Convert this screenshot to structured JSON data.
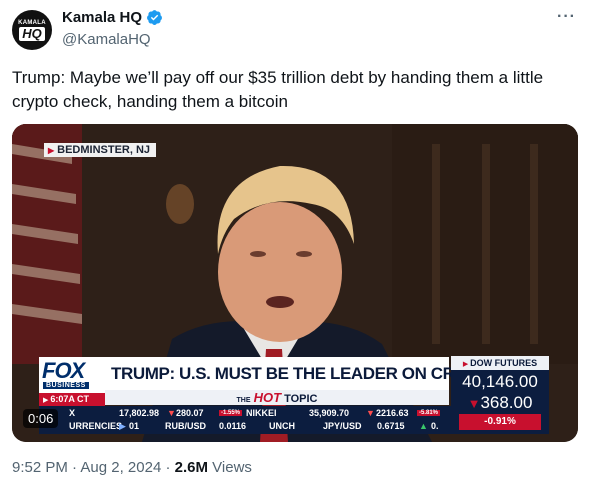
{
  "account": {
    "display_name": "Kamala HQ",
    "handle": "@KamalaHQ",
    "avatar_top": "KAMALA",
    "avatar_mid": "HQ",
    "verified": true,
    "more_label": "···"
  },
  "tweet": {
    "text": "Trump: Maybe we’ll pay off our $35 trillion debt by handing them a little crypto check, handing them a bitcoin"
  },
  "video": {
    "dateline": "BEDMINSTER, NJ",
    "timecode": "0:06",
    "chyron": {
      "network": "FOX",
      "network_sub": "BUSINESS",
      "local_time": "6:07A CT",
      "headline": "TRUMP: U.S. MUST BE THE LEADER ON CRYPTO",
      "hot_topic_the": "THE",
      "hot_topic_hot": "HOT",
      "hot_topic_topic": "TOPIC",
      "dow_title": "DOW FUTURES",
      "dow_value": "40,146.00",
      "dow_change": "368.00",
      "dow_pct": "-0.91%",
      "ticker_row1": {
        "label": "X",
        "val1": "17,802.98",
        "val2": "280.07",
        "pct1": "-1.55%",
        "name2": "NIKKEI",
        "val3": "35,909.70",
        "val4": "2216.63",
        "pct2": "-5.81%"
      },
      "ticker_row2": {
        "label": "URRENCIES",
        "arrow_val": "01",
        "pair1": "RUB/USD",
        "pair1_val": "0.0116",
        "word": "UNCH",
        "pair2": "JPY/USD",
        "pair2_val": "0.6715",
        "tail": "0."
      }
    }
  },
  "meta": {
    "time": "9:52 PM",
    "separator": "·",
    "date": "Aug 2, 2024",
    "views_count": "2.6M",
    "views_label": "Views"
  },
  "colors": {
    "verified_blue": "#1d9bf0",
    "fox_red": "#c8102e",
    "fox_navy": "#0c1d3f",
    "muted_text": "#536471"
  }
}
